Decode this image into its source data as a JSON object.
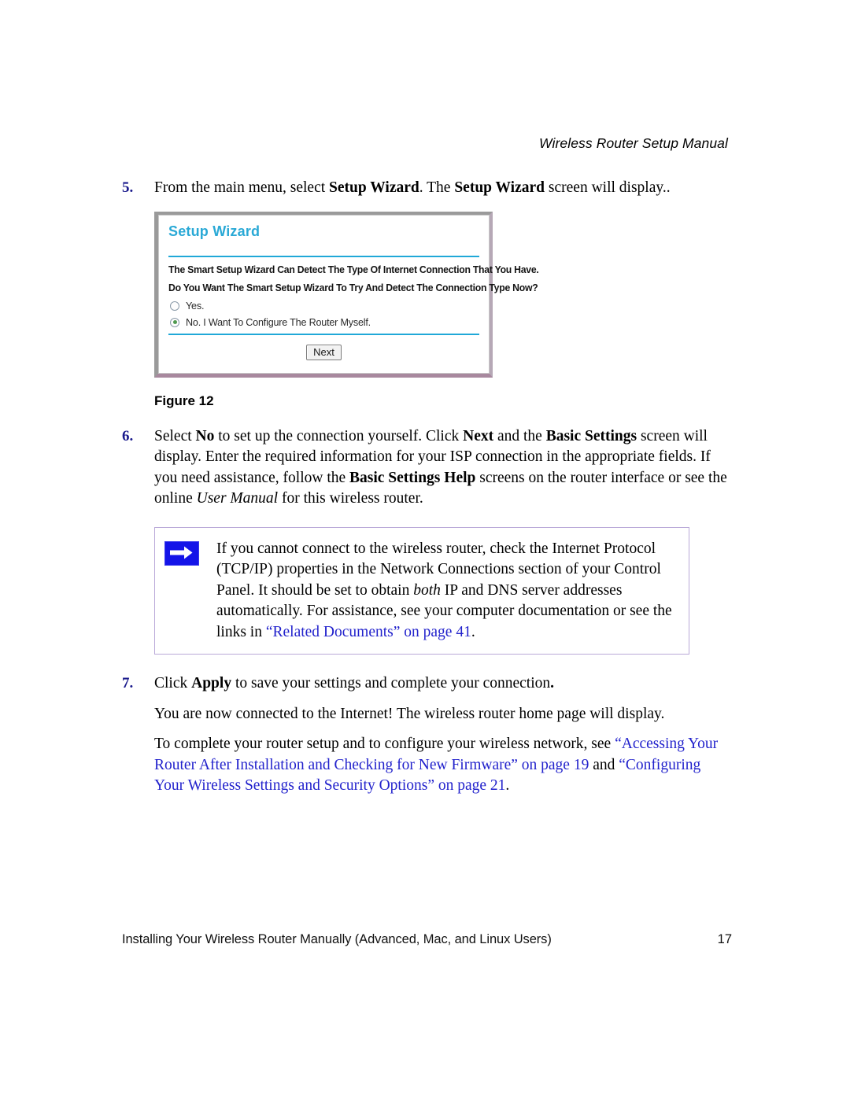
{
  "header": {
    "running_title": "Wireless Router Setup Manual"
  },
  "steps": [
    {
      "number": "5.",
      "segments": [
        {
          "text": "From the main menu, select ",
          "style": "normal"
        },
        {
          "text": "Setup Wizard",
          "style": "bold"
        },
        {
          "text": ". The ",
          "style": "normal"
        },
        {
          "text": "Setup Wizard",
          "style": "bold"
        },
        {
          "text": " screen will display..",
          "style": "normal"
        }
      ]
    },
    {
      "number": "6.",
      "segments": [
        {
          "text": "Select ",
          "style": "normal"
        },
        {
          "text": "No",
          "style": "bold"
        },
        {
          "text": " to set up the connection yourself. Click ",
          "style": "normal"
        },
        {
          "text": "Next",
          "style": "bold"
        },
        {
          "text": " and the ",
          "style": "normal"
        },
        {
          "text": "Basic Settings",
          "style": "bold"
        },
        {
          "text": " screen will display. Enter the required information for your ISP connection in the appropriate fields. If you need assistance, follow the ",
          "style": "normal"
        },
        {
          "text": "Basic Settings Help",
          "style": "bold"
        },
        {
          "text": " screens on the router interface or see the online ",
          "style": "normal"
        },
        {
          "text": "User Manual",
          "style": "italic"
        },
        {
          "text": " for this wireless router.",
          "style": "normal"
        }
      ]
    },
    {
      "number": "7.",
      "segments": [
        {
          "text": "Click ",
          "style": "normal"
        },
        {
          "text": "Apply",
          "style": "bold"
        },
        {
          "text": " to save your settings and complete your connection",
          "style": "normal"
        },
        {
          "text": ".",
          "style": "bold"
        }
      ]
    }
  ],
  "figure": {
    "caption": "Figure 12",
    "wizard": {
      "title": "Setup Wizard",
      "prompt_line_1": "The Smart Setup Wizard Can Detect The Type Of Internet Connection That You Have.",
      "prompt_line_2": "Do You Want The Smart Setup Wizard To Try And Detect The Connection Type Now?",
      "options": [
        {
          "label": "Yes.",
          "selected": false
        },
        {
          "label": "No. I Want To Configure The Router Myself.",
          "selected": true
        }
      ],
      "next_button_label": "Next",
      "accent_color": "#20a8d8",
      "title_color": "#2aa9d6",
      "selected_dot_color": "#4f9a4f"
    }
  },
  "note": {
    "icon_name": "blue-arrow-note-icon",
    "icon_color": "#1414e8",
    "border_color": "#b9a8d8",
    "segments": [
      {
        "text": "If you cannot connect to the wireless router, check the Internet Protocol (TCP/IP) properties in the Network Connections section of your Control Panel. It should be set to obtain ",
        "style": "normal"
      },
      {
        "text": "both",
        "style": "italic"
      },
      {
        "text": " IP and DNS server addresses automatically. For assistance, see your computer documentation or see the links in ",
        "style": "normal"
      },
      {
        "text": "“Related Documents” on page 41",
        "style": "link"
      },
      {
        "text": ".",
        "style": "normal"
      }
    ]
  },
  "paragraphs": [
    {
      "name": "connected-paragraph",
      "segments": [
        {
          "text": "You are now connected to the Internet! The wireless router home page will display.",
          "style": "normal"
        }
      ]
    },
    {
      "name": "cross-reference-paragraph",
      "segments": [
        {
          "text": "To complete your router setup and to configure your wireless network, see ",
          "style": "normal"
        },
        {
          "text": "“Accessing Your Router After Installation and Checking for New Firmware” on page 19",
          "style": "link"
        },
        {
          "text": " and ",
          "style": "normal"
        },
        {
          "text": "“Configuring Your Wireless Settings and Security Options” on page 21",
          "style": "link"
        },
        {
          "text": ".",
          "style": "normal"
        }
      ]
    }
  ],
  "footer": {
    "title": "Installing Your Wireless Router Manually (Advanced, Mac, and Linux Users)",
    "page_number": "17"
  },
  "colors": {
    "step_number": "#1a1a8c",
    "link": "#2222cc",
    "text": "#000000"
  }
}
